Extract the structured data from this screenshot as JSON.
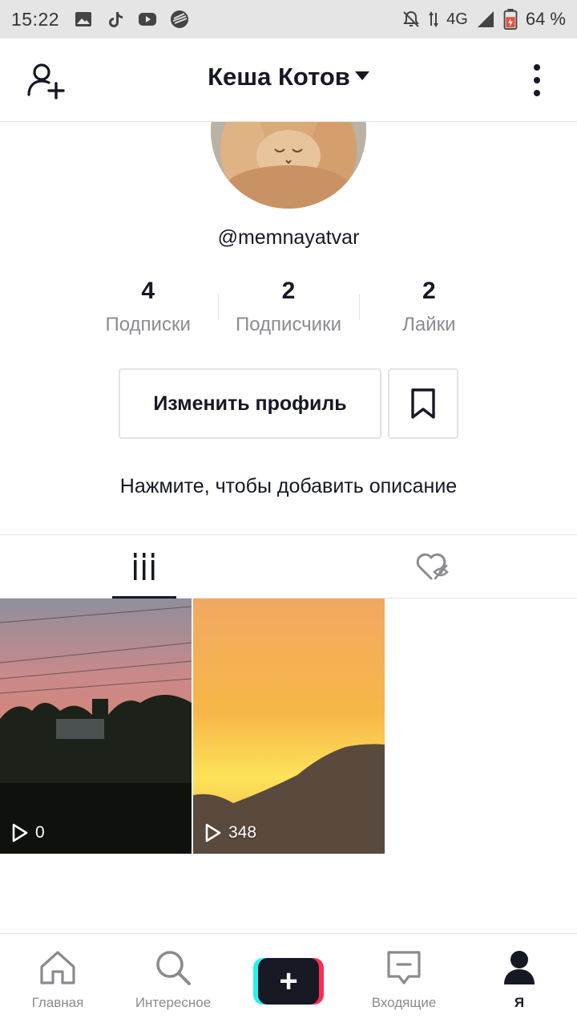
{
  "status_bar": {
    "time": "15:22",
    "network": "4G",
    "battery": "64 %"
  },
  "header": {
    "title": "Кеша Котов",
    "add_friend_icon": "person-add-icon",
    "menu_icon": "more-vertical-icon"
  },
  "profile": {
    "username": "@memnayatvar",
    "bio_placeholder": "Нажмите, чтобы добавить описание",
    "edit_label": "Изменить профиль"
  },
  "stats": [
    {
      "value": "4",
      "label": "Подписки"
    },
    {
      "value": "2",
      "label": "Подписчики"
    },
    {
      "value": "2",
      "label": "Лайки"
    }
  ],
  "videos": [
    {
      "plays": "0"
    },
    {
      "plays": "348"
    }
  ],
  "bottom_nav": {
    "items": [
      {
        "label": "Главная",
        "icon": "home-icon"
      },
      {
        "label": "Интересное",
        "icon": "search-icon"
      },
      {
        "label": "",
        "icon": "plus-icon"
      },
      {
        "label": "Входящие",
        "icon": "inbox-icon"
      },
      {
        "label": "Я",
        "icon": "profile-icon"
      }
    ]
  },
  "colors": {
    "text": "#161823",
    "muted": "#8a8b91",
    "border": "#e3e3e4",
    "accent_cyan": "#25f4ee",
    "accent_red": "#fe2c55"
  }
}
